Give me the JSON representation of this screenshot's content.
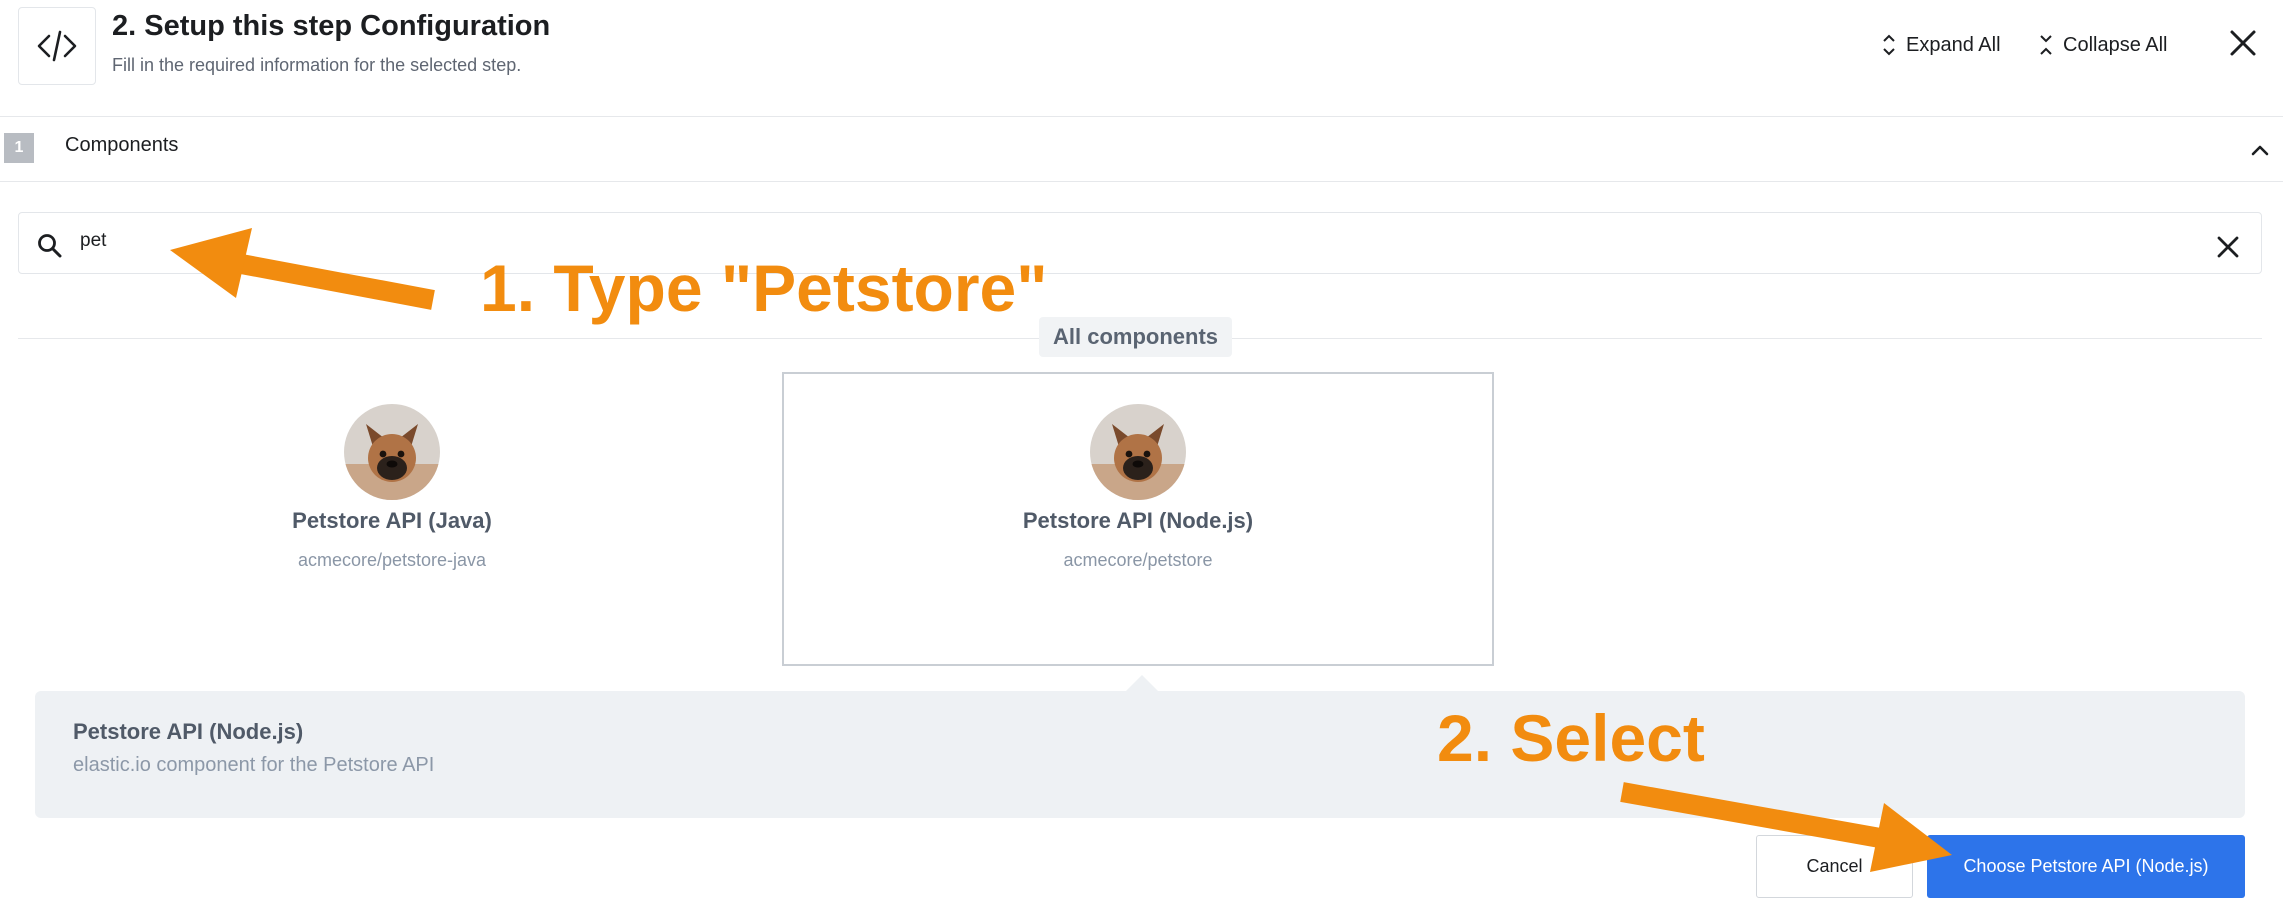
{
  "header": {
    "title": "2. Setup this step Configuration",
    "subtitle": "Fill in the required information for the selected step.",
    "expand_all": "Expand All",
    "collapse_all": "Collapse All",
    "icon": "code-icon"
  },
  "section": {
    "number": "1",
    "label": "Components"
  },
  "search": {
    "value": "pet",
    "placeholder": ""
  },
  "list_heading": "All components",
  "components": [
    {
      "name": "Petstore API (Java)",
      "path": "acmecore/petstore-java",
      "selected": false
    },
    {
      "name": "Petstore API (Node.js)",
      "path": "acmecore/petstore",
      "selected": true
    }
  ],
  "detail": {
    "title": "Petstore API (Node.js)",
    "description": "elastic.io component for the Petstore API"
  },
  "actions": {
    "cancel": "Cancel",
    "choose": "Choose Petstore API (Node.js)"
  },
  "annotations": {
    "step1": "1. Type \"Petstore\"",
    "step2": "2. Select"
  },
  "colors": {
    "accent": "#2d74ea",
    "annotation": "#f28c0f"
  }
}
